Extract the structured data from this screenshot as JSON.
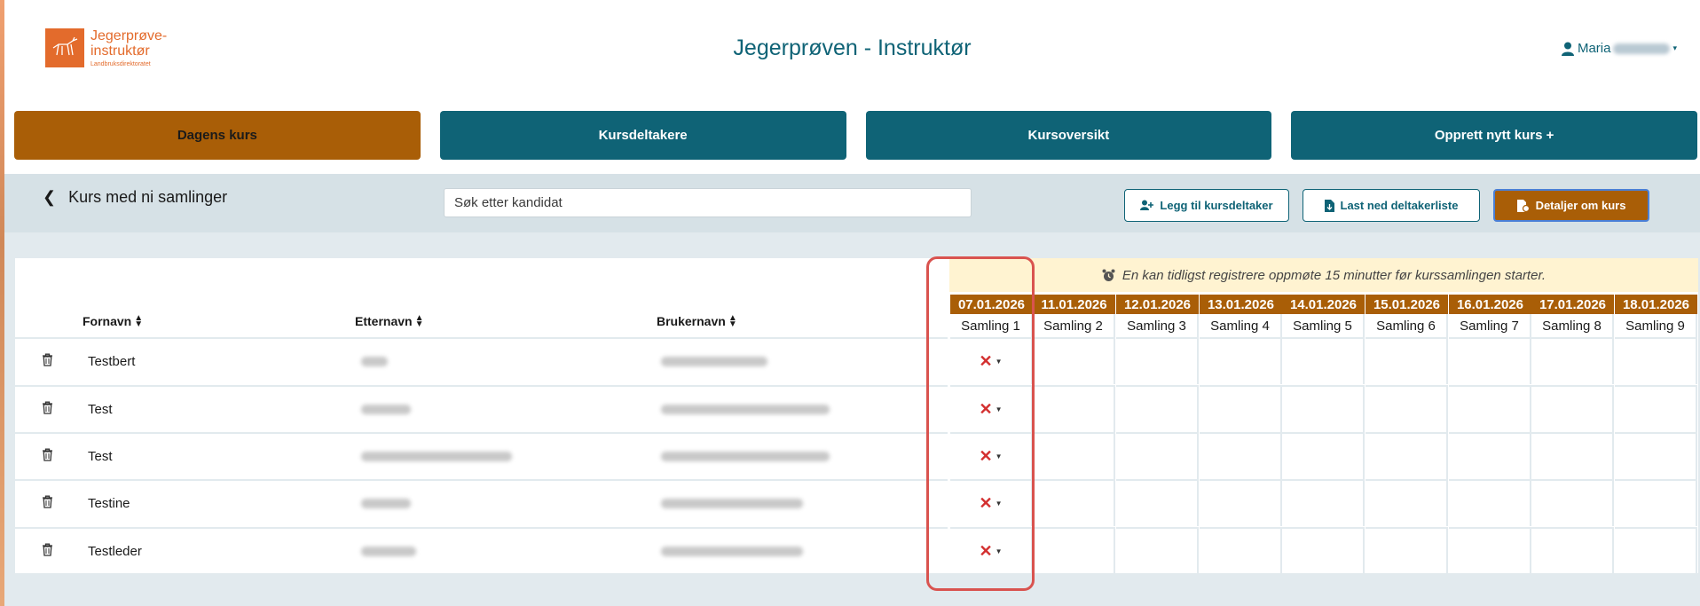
{
  "app": {
    "title": "Jegerprøven - Instruktør",
    "logo": {
      "line1": "Jegerprøve-",
      "line2": "instruktør",
      "sub": "Landbruksdirektoratet"
    },
    "user": {
      "name": "Maria"
    }
  },
  "nav": {
    "tabs": [
      {
        "label": "Dagens kurs",
        "active": true
      },
      {
        "label": "Kursdeltakere",
        "active": false
      },
      {
        "label": "Kursoversikt",
        "active": false
      },
      {
        "label": "Opprett nytt kurs +",
        "active": false
      }
    ]
  },
  "toolbar": {
    "back_label": "Kurs med ni samlinger",
    "search_placeholder": "Søk etter kandidat",
    "add_participant": "Legg til kursdeltaker",
    "download_list": "Last ned deltakerliste",
    "course_details": "Detaljer om kurs"
  },
  "notice": "En kan tidligst registrere oppmøte 15 minutter før kurssamlingen starter.",
  "table": {
    "columns": {
      "firstname": "Fornavn",
      "lastname": "Etternavn",
      "username": "Brukernavn"
    },
    "sessions": [
      {
        "date": "07.01.2026",
        "label": "Samling 1"
      },
      {
        "date": "11.01.2026",
        "label": "Samling 2"
      },
      {
        "date": "12.01.2026",
        "label": "Samling 3"
      },
      {
        "date": "13.01.2026",
        "label": "Samling 4"
      },
      {
        "date": "14.01.2026",
        "label": "Samling 5"
      },
      {
        "date": "15.01.2026",
        "label": "Samling 6"
      },
      {
        "date": "16.01.2026",
        "label": "Samling 7"
      },
      {
        "date": "17.01.2026",
        "label": "Samling 8"
      },
      {
        "date": "18.01.2026",
        "label": "Samling 9"
      }
    ],
    "rows": [
      {
        "firstname": "Testbert",
        "attendance_mark": "✕"
      },
      {
        "firstname": "Test",
        "attendance_mark": "✕"
      },
      {
        "firstname": "Test",
        "attendance_mark": "✕"
      },
      {
        "firstname": "Testine",
        "attendance_mark": "✕"
      },
      {
        "firstname": "Testleder",
        "attendance_mark": "✕"
      }
    ]
  },
  "colors": {
    "primary": "#0f6376",
    "accent": "#a95e07",
    "highlight": "#d9534f",
    "absent": "#d32f2f",
    "notice_bg": "#fff3d1"
  }
}
